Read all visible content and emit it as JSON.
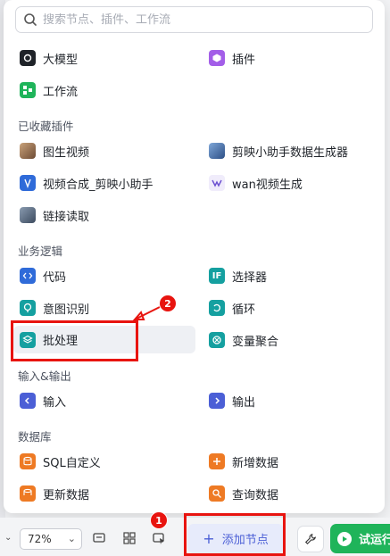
{
  "search": {
    "placeholder": "搜索节点、插件、工作流"
  },
  "top_items": [
    {
      "label": "大模型",
      "icon": "llm-icon"
    },
    {
      "label": "插件",
      "icon": "plugin-icon"
    },
    {
      "label": "工作流",
      "icon": "workflow-icon"
    }
  ],
  "favorites": {
    "title": "已收藏插件",
    "items": [
      {
        "label": "图生视频",
        "icon": "image-to-video-icon"
      },
      {
        "label": "剪映小助手数据生成器",
        "icon": "jianying-data-generator-icon"
      },
      {
        "label": "视频合成_剪映小助手",
        "icon": "video-compose-icon"
      },
      {
        "label": "wan视频生成",
        "icon": "wan-video-icon"
      },
      {
        "label": "链接读取",
        "icon": "link-reader-icon"
      }
    ]
  },
  "logic": {
    "title": "业务逻辑",
    "items": [
      {
        "label": "代码",
        "icon": "code-icon"
      },
      {
        "label": "选择器",
        "icon": "if-selector-icon"
      },
      {
        "label": "意图识别",
        "icon": "intent-icon"
      },
      {
        "label": "循环",
        "icon": "loop-icon"
      },
      {
        "label": "批处理",
        "icon": "batch-icon"
      },
      {
        "label": "变量聚合",
        "icon": "variable-aggregate-icon"
      }
    ]
  },
  "io": {
    "title": "输入&输出",
    "items": [
      {
        "label": "输入",
        "icon": "input-icon"
      },
      {
        "label": "输出",
        "icon": "output-icon"
      }
    ]
  },
  "database": {
    "title": "数据库",
    "items": [
      {
        "label": "SQL自定义",
        "icon": "sql-icon"
      },
      {
        "label": "新增数据",
        "icon": "add-data-icon"
      },
      {
        "label": "更新数据",
        "icon": "update-data-icon"
      },
      {
        "label": "查询数据",
        "icon": "query-data-icon"
      }
    ]
  },
  "toolbar": {
    "zoom": "72%",
    "add_node": "添加节点",
    "run": "试运行"
  },
  "annotations": {
    "one": "1",
    "two": "2"
  },
  "colors": {
    "accent": "#4b5fd6",
    "run": "#1fb45a",
    "highlight": "#e8140f",
    "teal": "#15a0a0",
    "orange": "#ee7a24"
  }
}
